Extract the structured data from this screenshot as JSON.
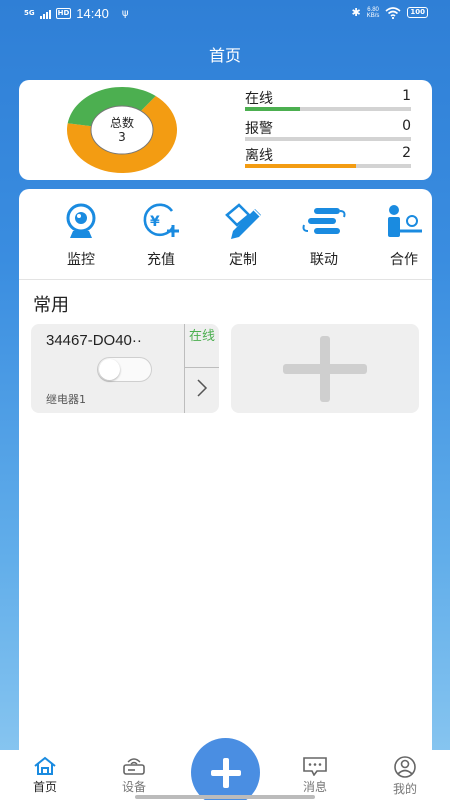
{
  "status_bar": {
    "network": "5G",
    "hd": "HD",
    "time": "14:40",
    "usb_icon": "usb-icon",
    "speed_value": "6.80",
    "speed_unit": "KB/s",
    "battery": "100"
  },
  "header": {
    "title": "首页"
  },
  "stats": {
    "total_label": "总数",
    "total_value": "3",
    "rows": [
      {
        "label": "在线",
        "count": "1",
        "fraction": 0.33,
        "color": "#4caf50"
      },
      {
        "label": "报警",
        "count": "0",
        "fraction": 0.0,
        "color": "#f44336"
      },
      {
        "label": "离线",
        "count": "2",
        "fraction": 0.67,
        "color": "#f39c12"
      }
    ]
  },
  "menu": {
    "items": [
      {
        "label": "监控",
        "icon": "camera-icon"
      },
      {
        "label": "充值",
        "icon": "yuan-plus-icon"
      },
      {
        "label": "定制",
        "icon": "edit-pencil-icon"
      },
      {
        "label": "联动",
        "icon": "linkage-icon"
      },
      {
        "label": "合作",
        "icon": "partner-icon"
      }
    ]
  },
  "favorites": {
    "title": "常用",
    "device": {
      "name": "34467-DO40··",
      "status": "在线",
      "subtitle": "继电器1",
      "toggle_on": false
    }
  },
  "bottom_nav": {
    "items": [
      {
        "label": "首页",
        "icon": "home-icon",
        "active": true
      },
      {
        "label": "设备",
        "icon": "router-icon",
        "active": false
      },
      {
        "label": "消息",
        "icon": "message-icon",
        "active": false
      },
      {
        "label": "我的",
        "icon": "user-icon",
        "active": false
      }
    ]
  },
  "colors": {
    "primary": "#2f7fd6",
    "online": "#4caf50",
    "offline": "#f39c12",
    "fab": "#4a8ee2"
  }
}
